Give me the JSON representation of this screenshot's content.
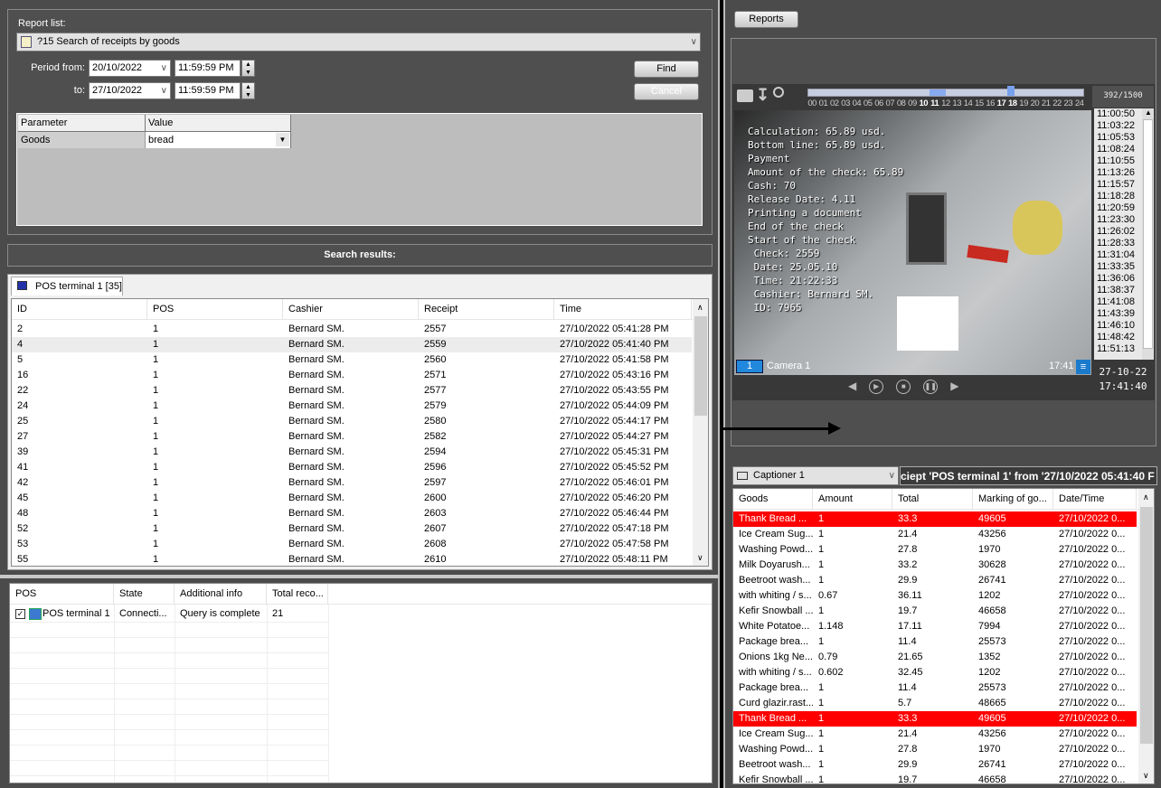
{
  "report": {
    "label": "Report list:",
    "selected": "?15 Search of receipts by goods",
    "period_from_label": "Period from:",
    "to_label": "to:",
    "from_date": "20/10/2022",
    "from_time": "11:59:59 PM",
    "to_date": "27/10/2022",
    "to_time": "11:59:59 PM",
    "find": "Find",
    "cancel": "Cancel",
    "params": {
      "headers": [
        "Parameter",
        "Value"
      ],
      "rows": [
        [
          "Goods",
          "bread"
        ]
      ]
    }
  },
  "search_results_title": "Search results:",
  "results_tab": "POS terminal 1 [35]",
  "results": {
    "headers": [
      "ID",
      "POS",
      "Cashier",
      "Receipt",
      "Time"
    ],
    "rows": [
      [
        "2",
        "1",
        "Bernard SM.",
        "2557",
        "27/10/2022 05:41:28 PM"
      ],
      [
        "4",
        "1",
        "Bernard SM.",
        "2559",
        "27/10/2022 05:41:40 PM"
      ],
      [
        "5",
        "1",
        "Bernard SM.",
        "2560",
        "27/10/2022 05:41:58 PM"
      ],
      [
        "16",
        "1",
        "Bernard SM.",
        "2571",
        "27/10/2022 05:43:16 PM"
      ],
      [
        "22",
        "1",
        "Bernard SM.",
        "2577",
        "27/10/2022 05:43:55 PM"
      ],
      [
        "24",
        "1",
        "Bernard SM.",
        "2579",
        "27/10/2022 05:44:09 PM"
      ],
      [
        "25",
        "1",
        "Bernard SM.",
        "2580",
        "27/10/2022 05:44:17 PM"
      ],
      [
        "27",
        "1",
        "Bernard SM.",
        "2582",
        "27/10/2022 05:44:27 PM"
      ],
      [
        "39",
        "1",
        "Bernard SM.",
        "2594",
        "27/10/2022 05:45:31 PM"
      ],
      [
        "41",
        "1",
        "Bernard SM.",
        "2596",
        "27/10/2022 05:45:52 PM"
      ],
      [
        "42",
        "1",
        "Bernard SM.",
        "2597",
        "27/10/2022 05:46:01 PM"
      ],
      [
        "45",
        "1",
        "Bernard SM.",
        "2600",
        "27/10/2022 05:46:20 PM"
      ],
      [
        "48",
        "1",
        "Bernard SM.",
        "2603",
        "27/10/2022 05:46:44 PM"
      ],
      [
        "52",
        "1",
        "Bernard SM.",
        "2607",
        "27/10/2022 05:47:18 PM"
      ],
      [
        "53",
        "1",
        "Bernard SM.",
        "2608",
        "27/10/2022 05:47:58 PM"
      ],
      [
        "55",
        "1",
        "Bernard SM.",
        "2610",
        "27/10/2022 05:48:11 PM"
      ]
    ],
    "selected_index": 1
  },
  "pos_table": {
    "headers": [
      "POS",
      "State",
      "Additional info",
      "Total reco..."
    ],
    "rows": [
      [
        "POS terminal 1",
        "Connecti...",
        "Query is complete",
        "21"
      ]
    ],
    "checked": true
  },
  "reports_button": "Reports",
  "video": {
    "counter": "392/1500",
    "timeline_labels": [
      "00",
      "01",
      "02",
      "03",
      "04",
      "05",
      "06",
      "07",
      "08",
      "09",
      "10",
      "11",
      "12",
      "13",
      "14",
      "15",
      "16",
      "17",
      "18",
      "19",
      "20",
      "21",
      "22",
      "23",
      "24"
    ],
    "overlay": [
      "Calculation: 65.89 usd.",
      "Bottom line: 65.89 usd.",
      "Payment",
      "Amount of the check: 65.89",
      "Cash: 70",
      "Release Date: 4.11",
      "Printing a document",
      "End of the check",
      "Start of the check",
      " Check: 2559",
      " Date: 25.05.10",
      " Time: 21:22:33",
      " Cashier: Bernard SM.",
      " ID: 7965"
    ],
    "camera_number": "1",
    "camera_name": "Camera 1",
    "clock": "17:41",
    "date": "27-10-22",
    "time": "17:41:40",
    "times": [
      "11:00:50",
      "11:03:22",
      "11:05:53",
      "11:08:24",
      "11:10:55",
      "11:13:26",
      "11:15:57",
      "11:18:28",
      "11:20:59",
      "11:23:30",
      "11:26:02",
      "11:28:33",
      "11:31:04",
      "11:33:35",
      "11:36:06",
      "11:38:37",
      "11:41:08",
      "11:43:39",
      "11:46:10",
      "11:48:42",
      "11:51:13"
    ]
  },
  "captioner": {
    "selected": "Captioner 1",
    "title": "ciept 'POS terminal 1' from '27/10/2022 05:41:40 F"
  },
  "goods": {
    "headers": [
      "Goods",
      "Amount",
      "Total",
      "Marking of go...",
      "Date/Time"
    ],
    "rows": [
      [
        "Thank Bread ...",
        "1",
        "33.3",
        "49605",
        "27/10/2022 0..."
      ],
      [
        "Ice Cream Sug...",
        "1",
        "21.4",
        "43256",
        "27/10/2022 0..."
      ],
      [
        "Washing Powd...",
        "1",
        "27.8",
        "1970",
        "27/10/2022 0..."
      ],
      [
        "Milk Doyarush...",
        "1",
        "33.2",
        "30628",
        "27/10/2022 0..."
      ],
      [
        "Beetroot wash...",
        "1",
        "29.9",
        "26741",
        "27/10/2022 0..."
      ],
      [
        "with whiting / s...",
        "0.67",
        "36.11",
        "1202",
        "27/10/2022 0..."
      ],
      [
        "Kefir Snowball ...",
        "1",
        "19.7",
        "46658",
        "27/10/2022 0..."
      ],
      [
        "White Potatoe...",
        "1.148",
        "17.11",
        "7994",
        "27/10/2022 0..."
      ],
      [
        "Package brea...",
        "1",
        "11.4",
        "25573",
        "27/10/2022 0..."
      ],
      [
        "Onions 1kg Ne...",
        "0.79",
        "21.65",
        "1352",
        "27/10/2022 0..."
      ],
      [
        "with whiting / s...",
        "0.602",
        "32.45",
        "1202",
        "27/10/2022 0..."
      ],
      [
        "Package brea...",
        "1",
        "11.4",
        "25573",
        "27/10/2022 0..."
      ],
      [
        "Curd glazir.rast....",
        "1",
        "5.7",
        "48665",
        "27/10/2022 0..."
      ],
      [
        "Thank Bread ...",
        "1",
        "33.3",
        "49605",
        "27/10/2022 0..."
      ],
      [
        "Ice Cream Sug...",
        "1",
        "21.4",
        "43256",
        "27/10/2022 0..."
      ],
      [
        "Washing Powd...",
        "1",
        "27.8",
        "1970",
        "27/10/2022 0..."
      ],
      [
        "Beetroot wash...",
        "1",
        "29.9",
        "26741",
        "27/10/2022 0..."
      ],
      [
        "Kefir Snowball ...",
        "1",
        "19.7",
        "46658",
        "27/10/2022 0..."
      ]
    ],
    "highlighted": [
      0,
      13
    ],
    "highlight_color": "#ff0000"
  }
}
